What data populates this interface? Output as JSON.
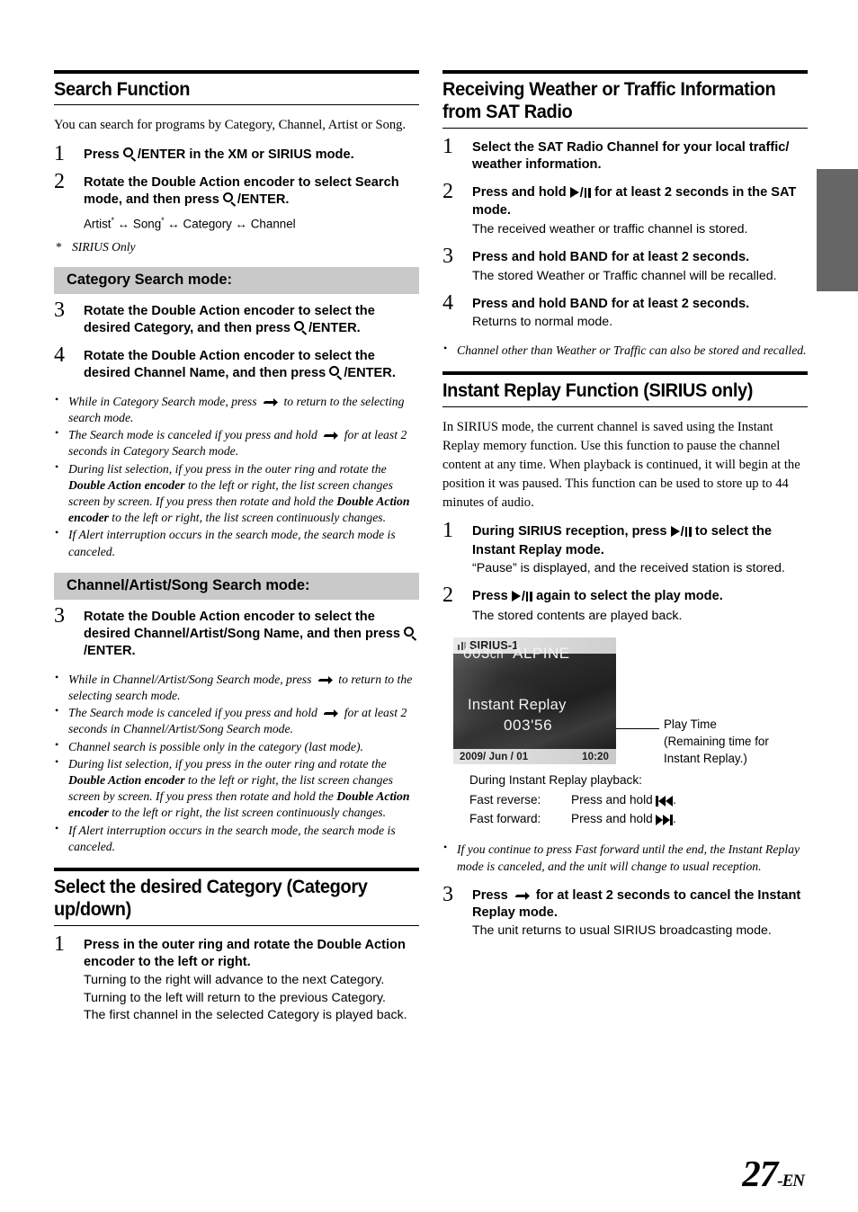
{
  "page": {
    "number": "27",
    "suffix": "-EN"
  },
  "left_column": {
    "search_function": {
      "title": "Search Function",
      "intro": "You can search for programs by Category, Channel, Artist or Song.",
      "step1": {
        "num": "1",
        "pre": "Press ",
        "mid": "/ENTER",
        "post": " in the XM or SIRIUS mode."
      },
      "step2": {
        "num": "2",
        "a": "Rotate the ",
        "b": "Double Action encoder",
        "c": " to select Search mode, and then press ",
        "d": "/ENTER."
      },
      "flow": {
        "a": "Artist",
        "b": "Song",
        "c": "Category",
        "d": "Channel",
        "sep": "↔"
      },
      "footnote": {
        "mark": "*",
        "text": "SIRIUS Only"
      }
    },
    "category_search": {
      "bar_label": "Category Search mode:",
      "step3": {
        "num": "3",
        "a": "Rotate the ",
        "b": "Double Action encoder",
        "c": " to select the desired Category, and then press ",
        "d": "/ENTER."
      },
      "step4": {
        "num": "4",
        "a": "Rotate the ",
        "b": "Double Action encoder",
        "c": " to select the desired Channel Name, and then press ",
        "d": "/ENTER."
      },
      "notes": [
        {
          "pre": "While in Category Search mode, press ",
          "icon": "return-icon",
          "post": " to return to the selecting search mode."
        },
        {
          "pre": "The Search mode is canceled if you press and hold ",
          "icon": "return-icon",
          "post": " for at least 2 seconds in Category Search mode."
        },
        {
          "pre": "During list selection, if you press in the outer ring and rotate the ",
          "b1": "Double Action encoder",
          "mid": " to the left or right, the list screen changes screen by screen. If you press then rotate and hold the ",
          "b2": "Double Action encoder",
          "post": " to the left or right, the list screen continuously changes."
        },
        {
          "pre": "If Alert interruption occurs in the search mode, the search mode is canceled."
        }
      ]
    },
    "cas_search": {
      "bar_label": "Channel/Artist/Song Search mode:",
      "step3": {
        "num": "3",
        "a": "Rotate the ",
        "b": "Double Action encoder",
        "c": " to select the desired Channel/Artist/Song Name, and then press ",
        "d": "/ENTER."
      },
      "notes": [
        {
          "pre": "While in Channel/Artist/Song Search mode, press ",
          "icon": "return-icon",
          "post": " to return to the selecting search mode."
        },
        {
          "pre": "The Search mode is canceled if you press and hold ",
          "icon": "return-icon",
          "post": " for at least 2 seconds in Channel/Artist/Song Search mode."
        },
        {
          "pre": "Channel search is possible only in the category (last mode)."
        },
        {
          "pre": "During list selection, if you press in the outer ring and rotate the ",
          "b1": "Double Action encoder",
          "mid": " to the left or right, the list screen changes screen by screen. If you press then rotate and hold the ",
          "b2": "Double Action encoder",
          "post": " to the left or right, the list screen continuously changes."
        },
        {
          "pre": "If Alert interruption occurs in the search mode, the search mode is canceled."
        }
      ]
    },
    "select_category": {
      "title": "Select the desired Category (Category up/down)",
      "step1": {
        "num": "1",
        "a": "Press in the outer ring and rotate the ",
        "b": "Double Action encoder",
        "c": " to the left or right.",
        "sub1": "Turning to the right will advance to the next Category.",
        "sub2": "Turning to the left will return to the previous Category.",
        "sub3": "The first channel in the selected Category is played back."
      }
    }
  },
  "right_column": {
    "weather_traffic": {
      "title": "Receiving Weather or Traffic Information from SAT Radio",
      "step1": {
        "num": "1",
        "head": "Select the SAT Radio Channel for your local traffic/ weather information."
      },
      "step2": {
        "num": "2",
        "pre": "Press and hold ",
        "post": " for at least 2 seconds in the SAT mode.",
        "sub": "The received weather or traffic channel is stored."
      },
      "step3": {
        "num": "3",
        "pre": "Press and hold ",
        "b": "BAND",
        "post": " for at least 2 seconds.",
        "sub": "The stored Weather or Traffic channel will be recalled."
      },
      "step4": {
        "num": "4",
        "pre": "Press and hold ",
        "b": "BAND",
        "post": " for at least 2 seconds.",
        "sub": "Returns to normal mode."
      },
      "notes": [
        {
          "pre": "Channel other than Weather or Traffic can also be stored and recalled."
        }
      ]
    },
    "instant_replay": {
      "title": "Instant Replay Function (SIRIUS only)",
      "intro": "In SIRIUS mode, the current channel is saved using the Instant Replay memory function. Use this function to pause the channel content at any time. When playback is continued, it will begin at the position it was paused. This function can be used to store up to 44 minutes of audio.",
      "step1": {
        "num": "1",
        "pre": "During SIRIUS reception, press ",
        "post": " to select the Instant Replay mode.",
        "sub": "“Pause” is displayed, and the received station is stored."
      },
      "step2": {
        "num": "2",
        "pre": "Press ",
        "post": " again to select the play mode.",
        "sub": "The stored contents are played back."
      },
      "lcd": {
        "status_label": "SIRIUS-1",
        "channel_number": "003",
        "channel_suffix": "ch",
        "channel_name": "ALPINE",
        "mode_text": "Instant Replay",
        "play_time": "003'56",
        "date": "2009/ Jun / 01",
        "clock": "10:20"
      },
      "callout": {
        "line1": "Play Time",
        "line2": "(Remaining time for",
        "line3": "Instant Replay.)"
      },
      "playback": {
        "lead": "During Instant Replay playback:",
        "rows": [
          {
            "k": "Fast reverse:",
            "v_pre": "Press and hold ",
            "icon": "fast-reverse-icon",
            "v_post": "."
          },
          {
            "k": "Fast forward:",
            "v_pre": "Press and hold ",
            "icon": "fast-forward-icon",
            "v_post": "."
          }
        ]
      },
      "notes": [
        {
          "pre": "If you continue to press Fast forward until the end, the Instant Replay mode is canceled, and the unit will change to usual reception."
        }
      ],
      "step3": {
        "num": "3",
        "pre": "Press ",
        "post": " for at least 2 seconds to cancel the Instant Replay mode.",
        "sub": "The unit returns to usual SIRIUS broadcasting mode."
      }
    }
  }
}
